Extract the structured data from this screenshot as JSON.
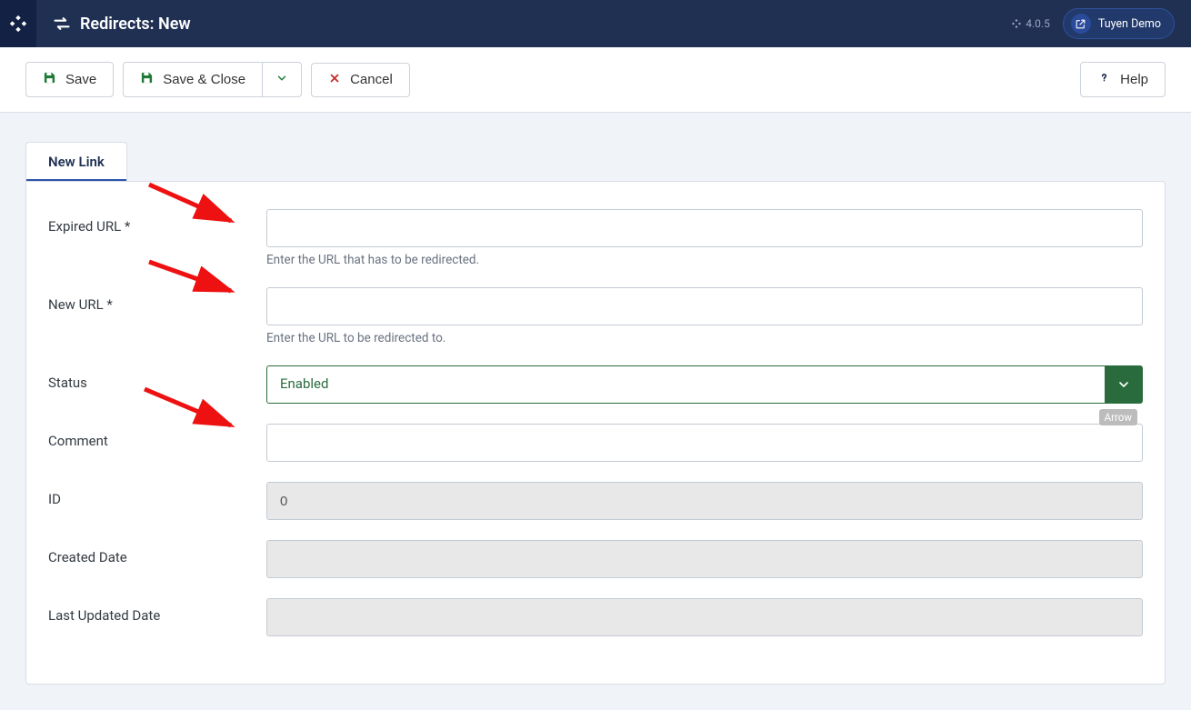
{
  "header": {
    "title": "Redirects: New",
    "version": "4.0.5",
    "user": "Tuyen Demo"
  },
  "toolbar": {
    "save": "Save",
    "save_close": "Save & Close",
    "cancel": "Cancel",
    "help": "Help"
  },
  "tabs": {
    "new_link": "New Link"
  },
  "form": {
    "expired_url": {
      "label": "Expired URL *",
      "help": "Enter the URL that has to be redirected."
    },
    "new_url": {
      "label": "New URL *",
      "help": "Enter the URL to be redirected to."
    },
    "status": {
      "label": "Status",
      "value": "Enabled"
    },
    "comment": {
      "label": "Comment",
      "tooltip": "Arrow"
    },
    "id": {
      "label": "ID",
      "value": "0"
    },
    "created": {
      "label": "Created Date",
      "value": ""
    },
    "updated": {
      "label": "Last Updated Date",
      "value": ""
    }
  }
}
